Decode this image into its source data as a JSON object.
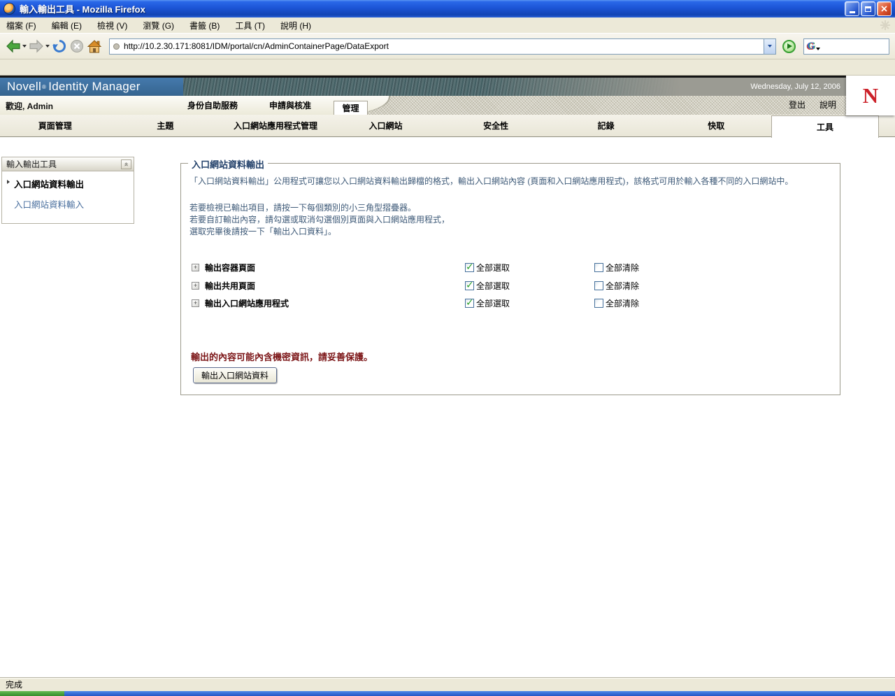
{
  "window": {
    "title": "輸入輸出工具 - Mozilla Firefox"
  },
  "menu": {
    "items": [
      "檔案 (F)",
      "編輯 (E)",
      "檢視 (V)",
      "瀏覽 (G)",
      "書籤 (B)",
      "工具 (T)",
      "說明 (H)"
    ]
  },
  "toolbar": {
    "url": "http://10.2.30.171:8081/IDM/portal/cn/AdminContainerPage/DataExport",
    "search_logo": "G"
  },
  "banner": {
    "brand": "Novell",
    "registered_mark": "®",
    "product": "Identity Manager",
    "date": "Wednesday, July 12, 2006",
    "logo_letter": "N"
  },
  "welcome": {
    "message": "歡迎, Admin",
    "tabs": [
      {
        "label": "身份自助服務",
        "active": false
      },
      {
        "label": "申請與核准",
        "active": false
      },
      {
        "label": "管理",
        "active": true
      }
    ],
    "logout_label": "登出",
    "help_label": "說明"
  },
  "subtabs": {
    "items": [
      "頁面管理",
      "主題",
      "入口網站應用程式管理",
      "入口網站",
      "安全性",
      "記錄",
      "快取",
      "工具"
    ],
    "active": "工具"
  },
  "sidebar": {
    "header": "輸入輸出工具",
    "items": [
      {
        "label": "入口網站資料輸出",
        "active": true
      },
      {
        "label": "入口網站資料輸入",
        "active": false
      }
    ]
  },
  "content": {
    "legend": "入口網站資料輸出",
    "intro": "「入口網站資料輸出」公用程式可讓您以入口網站資料輸出歸檔的格式，輸出入口網站內容 (頁面和入口網站應用程式)，該格式可用於輸入各種不同的入口網站中。",
    "instructions": [
      "若要檢視已輸出項目，請按一下每個類別的小三角型摺疊器。",
      "若要自訂輸出內容，請勾選或取消勾選個別頁面與入口網站應用程式，",
      "選取完畢後請按一下「輸出入口資料」。"
    ],
    "rows": [
      {
        "label": "輸出容器頁面",
        "select_label": "全部選取",
        "select_checked": true,
        "clear_label": "全部清除",
        "clear_checked": false
      },
      {
        "label": "輸出共用頁面",
        "select_label": "全部選取",
        "select_checked": true,
        "clear_label": "全部清除",
        "clear_checked": false
      },
      {
        "label": "輸出入口網站應用程式",
        "select_label": "全部選取",
        "select_checked": true,
        "clear_label": "全部清除",
        "clear_checked": false
      }
    ],
    "warning": "輸出的內容可能內含機密資訊，請妥善保護。",
    "export_button_label": "輸出入口網站資料"
  },
  "statusbar": {
    "text": "完成"
  },
  "colors": {
    "banner_blue": "#3a6a9e",
    "novell_red": "#cc2129",
    "link_blue": "#4a6f9e",
    "legend_navy": "#24426b",
    "body_text": "#3e5a78",
    "warning_red": "#7b1416",
    "check_green": "#2ca02c"
  }
}
